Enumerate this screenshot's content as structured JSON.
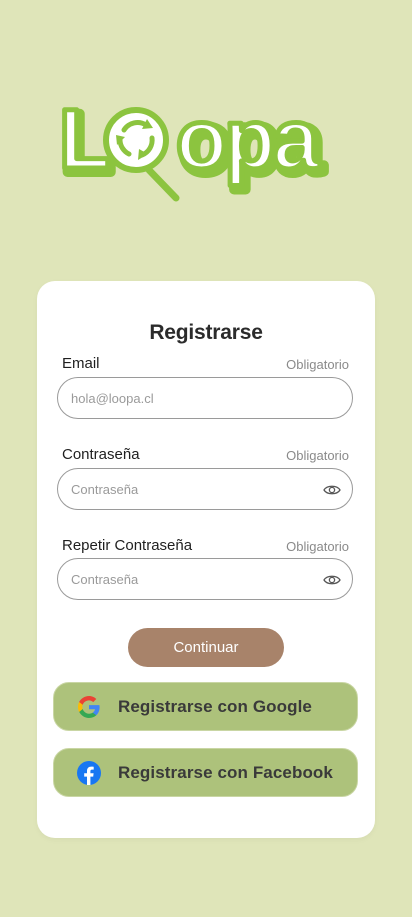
{
  "brand": {
    "logo_text": "Loopa"
  },
  "form": {
    "title": "Registrarse",
    "email": {
      "label": "Email",
      "required": "Obligatorio",
      "placeholder": "hola@loopa.cl"
    },
    "password": {
      "label": "Contraseña",
      "required": "Obligatorio",
      "placeholder": "Contraseña"
    },
    "repeat_password": {
      "label": "Repetir Contraseña",
      "required": "Obligatorio",
      "placeholder": "Contraseña"
    },
    "continue_label": "Continuar",
    "google_label": "Registrarse con Google",
    "facebook_label": "Registrarse con Facebook"
  },
  "icons": {
    "password_toggle": "eye-icon",
    "google": "google-icon",
    "facebook": "facebook-icon",
    "logo_mark": "recycle-magnifier-icon"
  },
  "colors": {
    "background": "#dfe5b9",
    "brand_green": "#8cc43f",
    "continue_button": "#a8836a",
    "social_button": "#adc27b"
  }
}
